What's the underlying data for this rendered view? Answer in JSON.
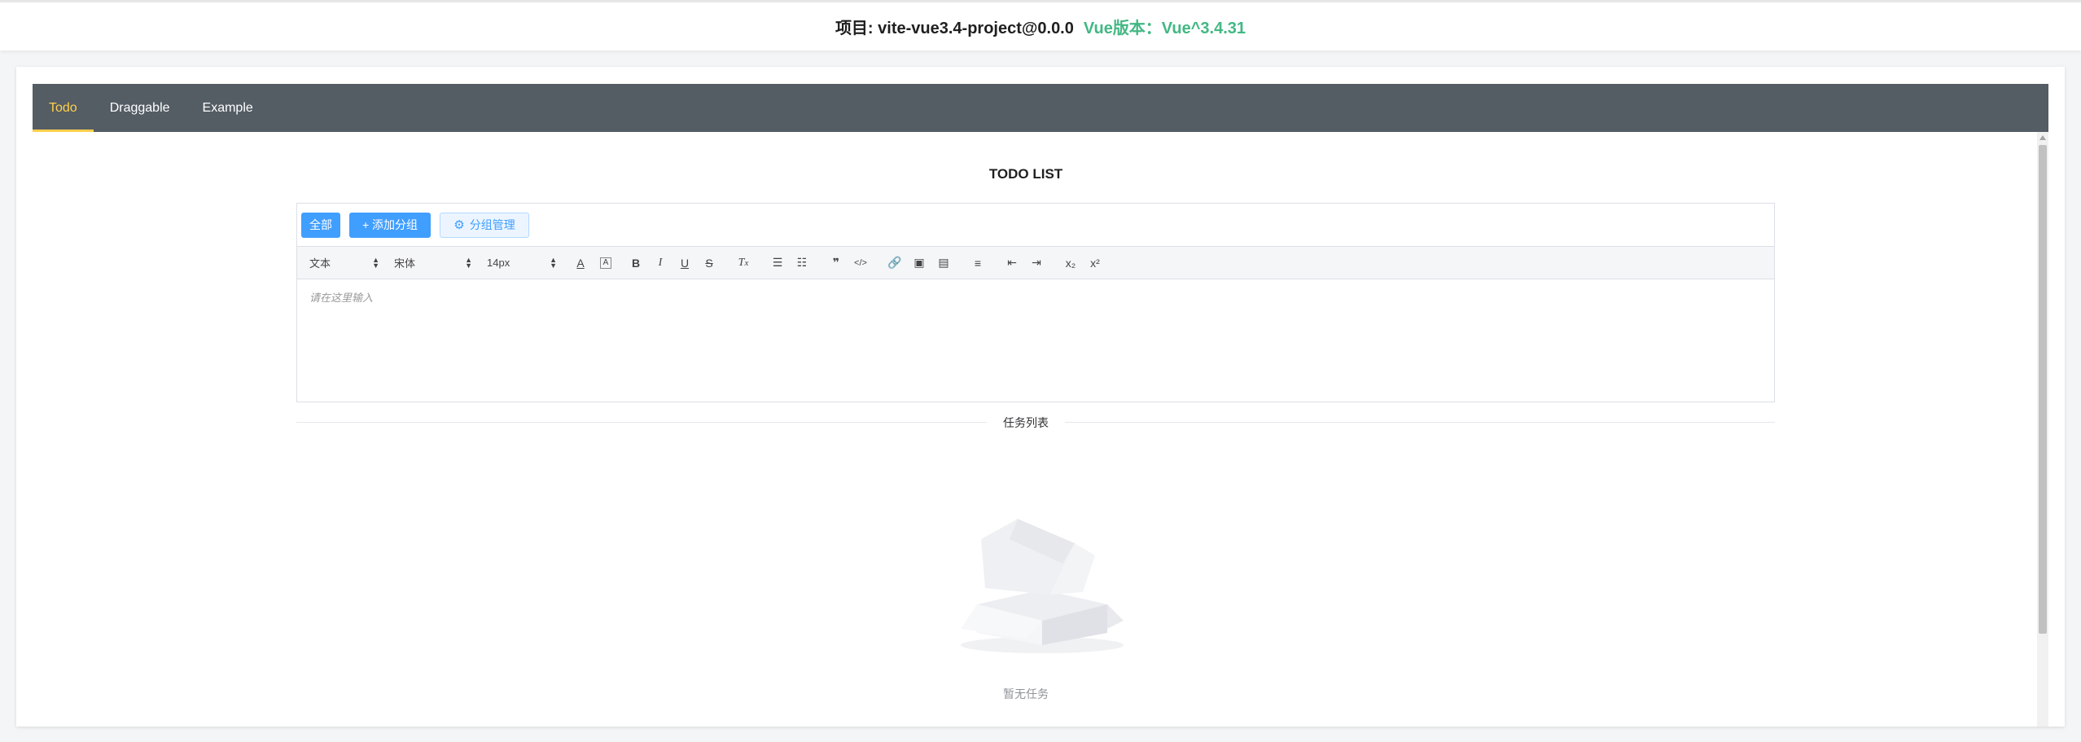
{
  "header": {
    "project": "项目: vite-vue3.4-project@0.0.0",
    "vue_version": "Vue版本：Vue^3.4.31"
  },
  "nav": {
    "items": [
      {
        "label": "Todo",
        "active": true
      },
      {
        "label": "Draggable",
        "active": false
      },
      {
        "label": "Example",
        "active": false
      }
    ],
    "active_color": "#ffd04b",
    "bg_color": "#545c64"
  },
  "page": {
    "title": "TODO LIST"
  },
  "groups": {
    "all_label": "全部",
    "add_label": "+ 添加分组",
    "manage_label": "分组管理"
  },
  "toolbar": {
    "header_value": "文本",
    "font_value": "宋体",
    "size_value": "14px",
    "subscript": "x₂",
    "superscript": "x²"
  },
  "editor": {
    "placeholder": "请在这里输入"
  },
  "task_list": {
    "divider_label": "任务列表",
    "empty_text": "暂无任务"
  },
  "colors": {
    "primary": "#409eff",
    "vue_green": "#42b883"
  }
}
